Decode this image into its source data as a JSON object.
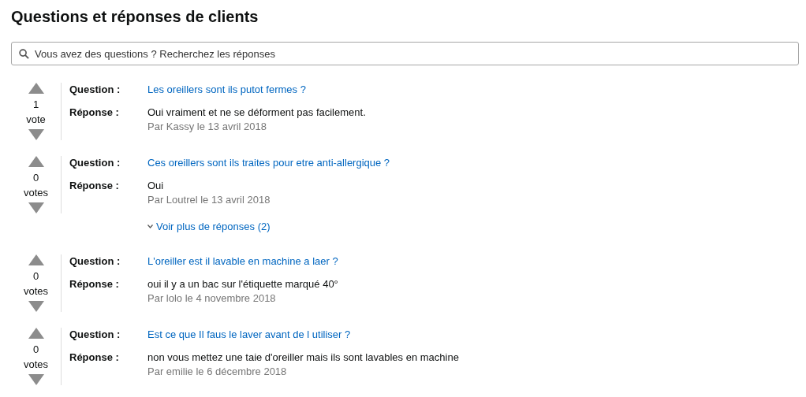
{
  "title": "Questions et réponses de clients",
  "search": {
    "placeholder": "Vous avez des questions ? Recherchez les réponses"
  },
  "items": [
    {
      "votes": "1",
      "votes_label": "vote",
      "question_label": "Question :",
      "question": "Les oreillers sont ils putot fermes ?",
      "answer_label": "Réponse :",
      "answer": "Oui vraiment et ne se déforment pas facilement.",
      "byline": "Par Kassy le 13 avril 2018"
    },
    {
      "votes": "0",
      "votes_label": "votes",
      "question_label": "Question :",
      "question": "Ces oreillers sont ils traites pour etre anti-allergique ?",
      "answer_label": "Réponse :",
      "answer": "Oui",
      "byline": "Par Loutrel le 13 avril 2018",
      "more_link": "Voir plus de réponses (2)"
    },
    {
      "votes": "0",
      "votes_label": "votes",
      "question_label": "Question :",
      "question": "L'oreiller est il lavable en machine a laer ?",
      "answer_label": "Réponse :",
      "answer": "oui il y a un bac sur l'étiquette marqué 40°",
      "byline": "Par lolo le 4 novembre 2018"
    },
    {
      "votes": "0",
      "votes_label": "votes",
      "question_label": "Question :",
      "question": "Est ce que Il faus le laver avant de l utiliser ?",
      "answer_label": "Réponse :",
      "answer": "non vous mettez une taie d'oreiller mais ils sont lavables en machine",
      "byline": "Par emilie le 6 décembre 2018"
    }
  ]
}
